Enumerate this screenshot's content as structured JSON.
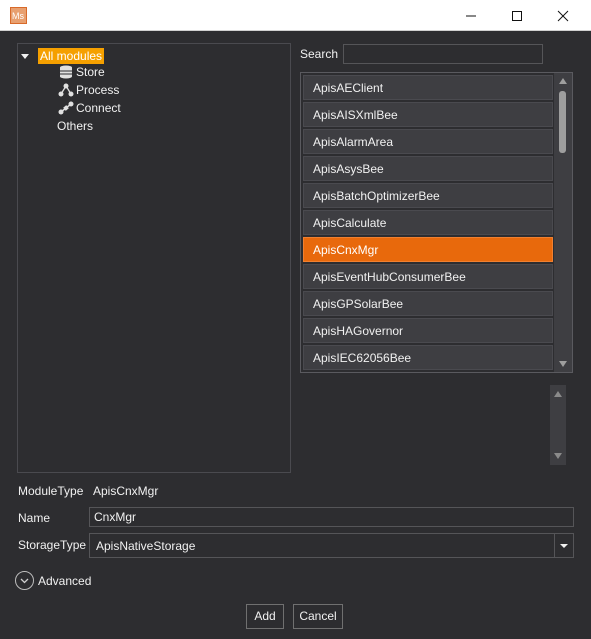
{
  "window": {
    "app_icon_text": "Ms",
    "controls": [
      "minimize",
      "maximize",
      "close"
    ]
  },
  "tree": {
    "root": "All modules",
    "children": [
      {
        "label": "Store",
        "icon": "database-icon"
      },
      {
        "label": "Process",
        "icon": "process-icon"
      },
      {
        "label": "Connect",
        "icon": "connect-icon"
      },
      {
        "label": "Others",
        "icon": ""
      }
    ]
  },
  "search": {
    "label": "Search",
    "value": ""
  },
  "module_list": {
    "items": [
      "ApisAEClient",
      "ApisAISXmlBee",
      "ApisAlarmArea",
      "ApisAsysBee",
      "ApisBatchOptimizerBee",
      "ApisCalculate",
      "ApisCnxMgr",
      "ApisEventHubConsumerBee",
      "ApisGPSolarBee",
      "ApisHAGovernor",
      "ApisIEC62056Bee"
    ],
    "selected_index": 6
  },
  "form": {
    "module_type_label": "ModuleType",
    "module_type_value": "ApisCnxMgr",
    "name_label": "Name",
    "name_value": "CnxMgr",
    "storage_type_label": "StorageType",
    "storage_type_value": "ApisNativeStorage"
  },
  "advanced": {
    "label": "Advanced"
  },
  "buttons": {
    "add": "Add",
    "cancel": "Cancel"
  },
  "colors": {
    "background": "#2d2d30",
    "accent": "#e8690c",
    "tree_highlight": "#f5a000"
  }
}
